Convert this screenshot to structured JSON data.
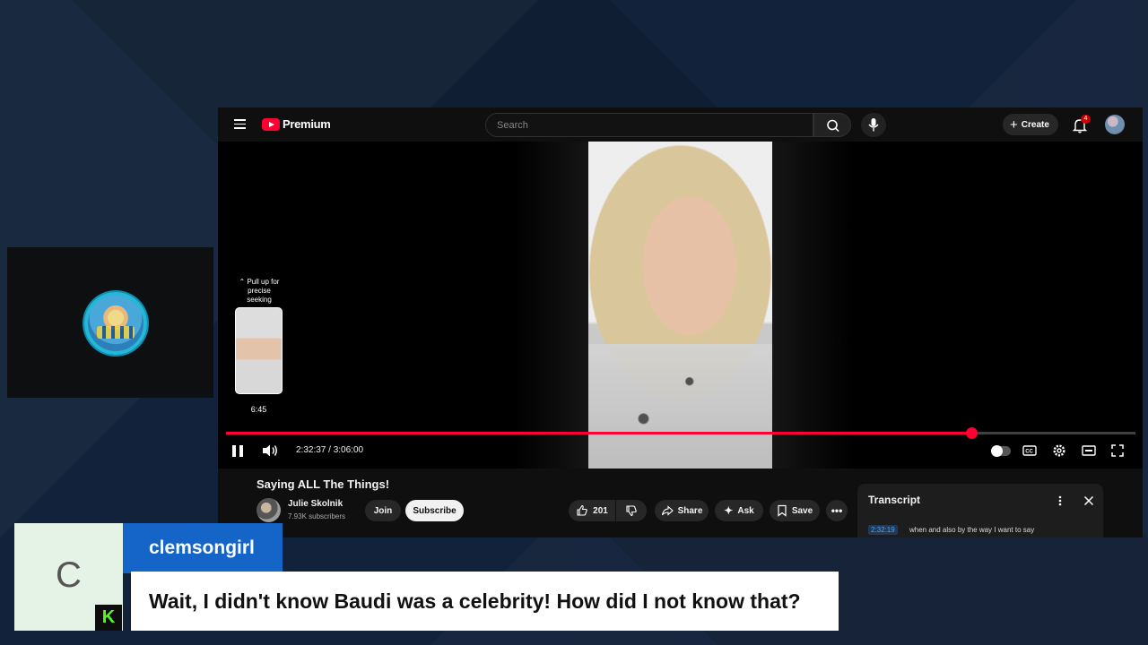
{
  "colors": {
    "accent_red": "#ff0033",
    "chat_name_bg": "#1565c8",
    "chat_avatar_bg": "#e4f3e6",
    "kick_green": "#53fc18"
  },
  "topbar": {
    "logo_text": "Premium",
    "search_placeholder": "Search",
    "create_label": "Create",
    "notification_count": "4"
  },
  "player": {
    "seek_hint": "Pull up for precise seeking",
    "seek_preview_time": "6:45",
    "current_time": "2:32:37",
    "duration": "3:06:00",
    "time_display": "2:32:37 / 3:06:00",
    "progress_fraction": 0.82,
    "hover_fraction": 0.037
  },
  "video": {
    "title": "Saying ALL The Things!",
    "channel_name": "Julie Skolnik",
    "subscribers": "7.93K subscribers",
    "join_label": "Join",
    "subscribe_label": "Subscribe",
    "like_count": "201",
    "share_label": "Share",
    "ask_label": "Ask",
    "save_label": "Save"
  },
  "transcript": {
    "title": "Transcript",
    "timestamp": "2:32:19",
    "line": "when and also by the way I want to say"
  },
  "chat": {
    "avatar_letter": "C",
    "username": "clemsongirl",
    "message": "Wait, I didn't know Baudi was a celebrity! How did I not know that?",
    "platform_icon": "K"
  }
}
